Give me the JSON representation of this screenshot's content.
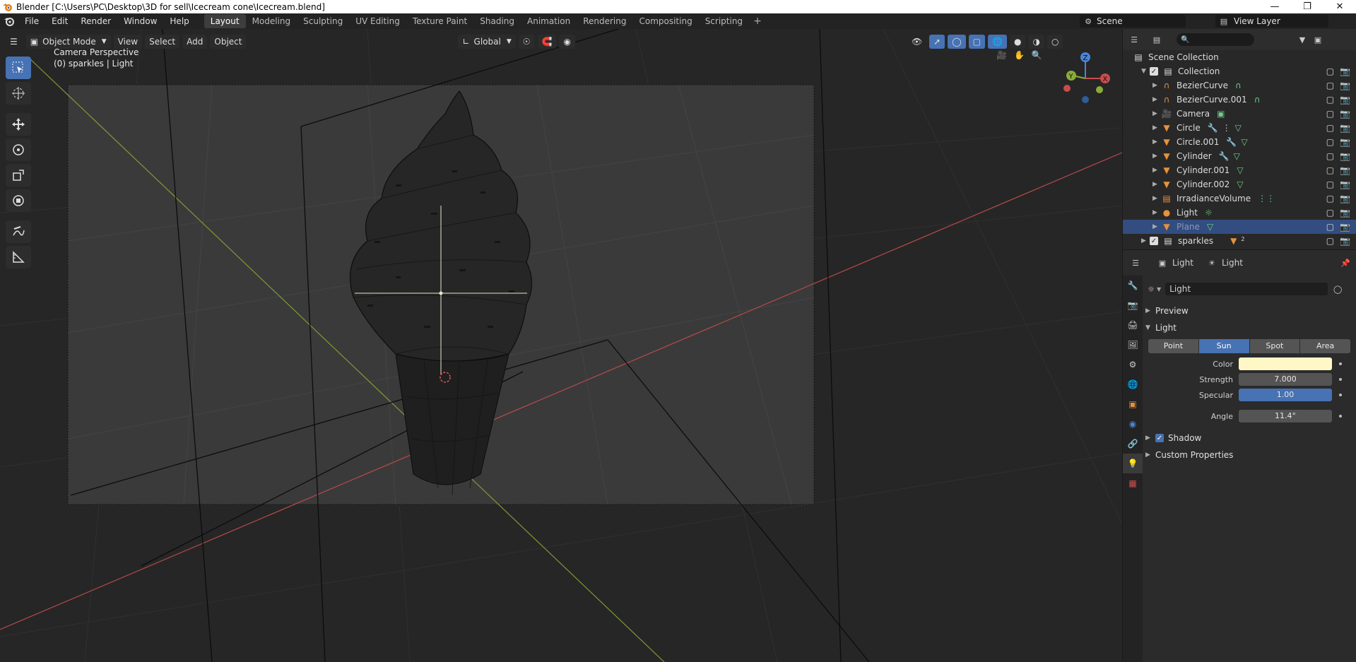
{
  "titlebar": {
    "title": "Blender [C:\\Users\\PC\\Desktop\\3D for sell\\Icecream cone\\Icecream.blend]"
  },
  "menu": [
    "File",
    "Edit",
    "Render",
    "Window",
    "Help"
  ],
  "workspaces": [
    "Layout",
    "Modeling",
    "Sculpting",
    "UV Editing",
    "Texture Paint",
    "Shading",
    "Animation",
    "Rendering",
    "Compositing",
    "Scripting"
  ],
  "active_workspace": "Layout",
  "scene": "Scene",
  "view_layer": "View Layer",
  "viewport_header": {
    "mode": "Object Mode",
    "menus": [
      "View",
      "Select",
      "Add",
      "Object"
    ],
    "orientation": "Global"
  },
  "viewport": {
    "perspective": "Camera Perspective",
    "context": "(0) sparkles | Light"
  },
  "outliner": {
    "root": "Scene Collection",
    "collection": "Collection",
    "items": [
      {
        "name": "BezierCurve",
        "icon": "curve-icon"
      },
      {
        "name": "BezierCurve.001",
        "icon": "curve-icon"
      },
      {
        "name": "Camera",
        "icon": "camera-icon"
      },
      {
        "name": "Circle",
        "icon": "mesh-icon"
      },
      {
        "name": "Circle.001",
        "icon": "mesh-icon"
      },
      {
        "name": "Cylinder",
        "icon": "mesh-icon"
      },
      {
        "name": "Cylinder.001",
        "icon": "mesh-icon"
      },
      {
        "name": "Cylinder.002",
        "icon": "mesh-icon"
      },
      {
        "name": "IrradianceVolume",
        "icon": "lightprobe-icon"
      },
      {
        "name": "Light",
        "icon": "light-icon"
      },
      {
        "name": "Plane",
        "icon": "mesh-icon"
      }
    ],
    "second_collection": "sparkles",
    "sparkles_badge": "2"
  },
  "properties": {
    "breadcrumb_object": "Light",
    "breadcrumb_data": "Light",
    "datablock": "Light",
    "panels": {
      "preview": "Preview",
      "light": "Light",
      "shadow": "Shadow",
      "custom": "Custom Properties"
    },
    "light_types": [
      "Point",
      "Sun",
      "Spot",
      "Area"
    ],
    "active_type": "Sun",
    "fields": [
      {
        "label": "Color",
        "value": "",
        "kind": "color",
        "color": "#fff8c6"
      },
      {
        "label": "Strength",
        "value": "7.000",
        "kind": "num"
      },
      {
        "label": "Specular",
        "value": "1.00",
        "kind": "blue"
      },
      {
        "label": "Angle",
        "value": "11.4°",
        "kind": "num"
      }
    ]
  },
  "colors": {
    "accent": "#4772b3",
    "selection_row": "#334d80",
    "x_axis": "#c94c4c",
    "y_axis": "#8aac3b",
    "z_axis": "#4a86d6"
  }
}
